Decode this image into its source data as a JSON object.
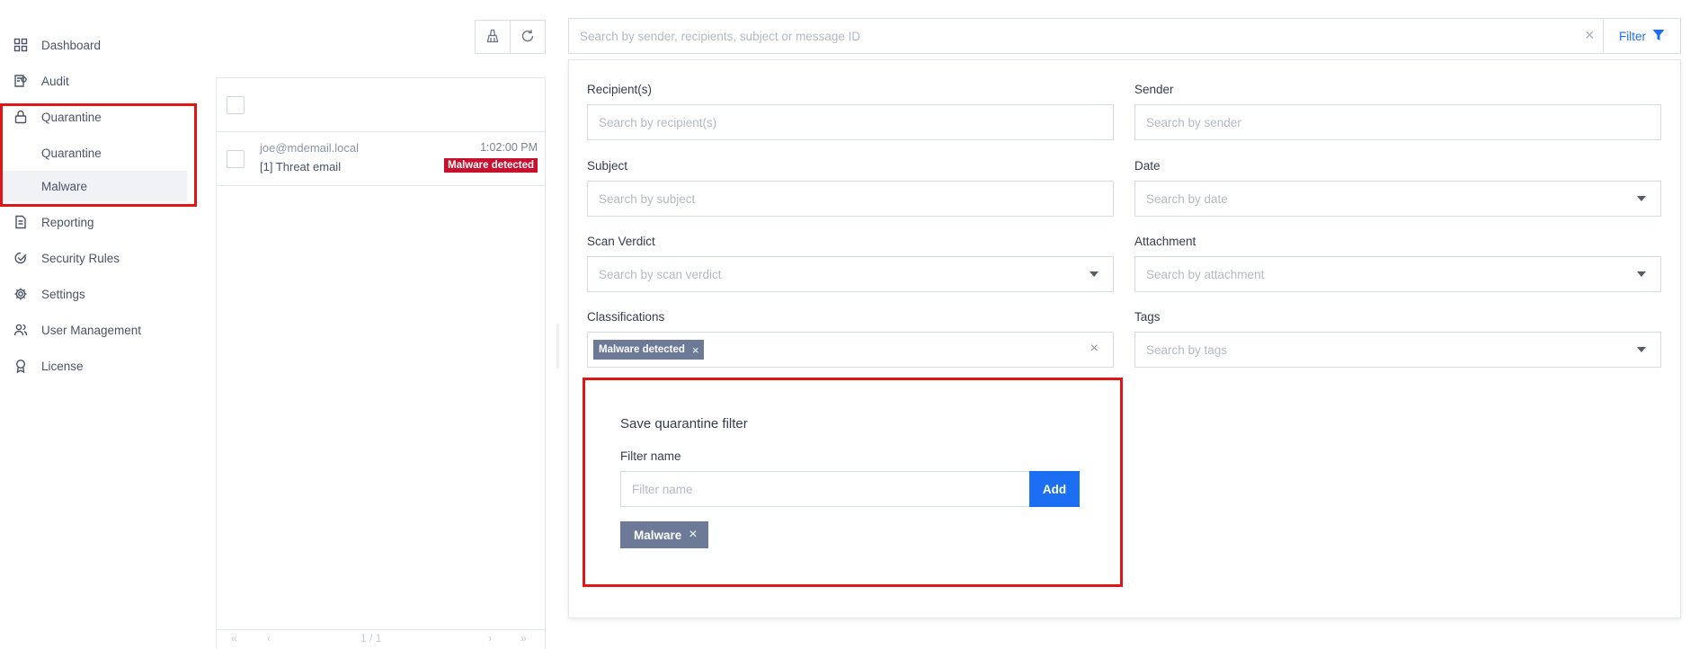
{
  "sidebar": {
    "items": [
      {
        "label": "Dashboard",
        "icon": "grid-icon"
      },
      {
        "label": "Audit",
        "icon": "audit-icon"
      },
      {
        "label": "Quarantine",
        "icon": "lock-icon"
      },
      {
        "label": "Reporting",
        "icon": "document-icon"
      },
      {
        "label": "Security Rules",
        "icon": "shield-check-icon"
      },
      {
        "label": "Settings",
        "icon": "gear-icon"
      },
      {
        "label": "User Management",
        "icon": "users-icon"
      },
      {
        "label": "License",
        "icon": "award-icon"
      }
    ],
    "quarantine_sub": [
      {
        "label": "Quarantine"
      },
      {
        "label": "Malware"
      }
    ]
  },
  "message_list": {
    "messages": [
      {
        "from": "joe@mdemail.local",
        "subject": "[1] Threat email",
        "time": "1:02:00 PM",
        "badge": "Malware detected"
      }
    ],
    "pager": {
      "first": "«",
      "prev": "‹",
      "info": "1 / 1",
      "next": "›",
      "last": "»"
    }
  },
  "search": {
    "placeholder": "Search by sender, recipients, subject or message ID",
    "clear": "×",
    "filter_label": "Filter"
  },
  "filters": {
    "recipients": {
      "label": "Recipient(s)",
      "placeholder": "Search by recipient(s)"
    },
    "sender": {
      "label": "Sender",
      "placeholder": "Search by sender"
    },
    "subject": {
      "label": "Subject",
      "placeholder": "Search by subject"
    },
    "date": {
      "label": "Date",
      "placeholder": "Search by date"
    },
    "scan_verdict": {
      "label": "Scan Verdict",
      "placeholder": "Search by scan verdict"
    },
    "attachment": {
      "label": "Attachment",
      "placeholder": "Search by attachment"
    },
    "classifications": {
      "label": "Classifications",
      "chips": [
        "Malware detected"
      ],
      "clear": "×"
    },
    "tags": {
      "label": "Tags",
      "placeholder": "Search by tags"
    }
  },
  "save_filter": {
    "title": "Save quarantine filter",
    "name_label": "Filter name",
    "name_placeholder": "Filter name",
    "add_label": "Add",
    "saved": [
      {
        "label": "Malware",
        "remove": "×"
      }
    ]
  },
  "colors": {
    "accent": "#1c6ff2",
    "danger": "#c8102e",
    "chip": "#6c7a98",
    "highlight_box": "#e01616"
  }
}
